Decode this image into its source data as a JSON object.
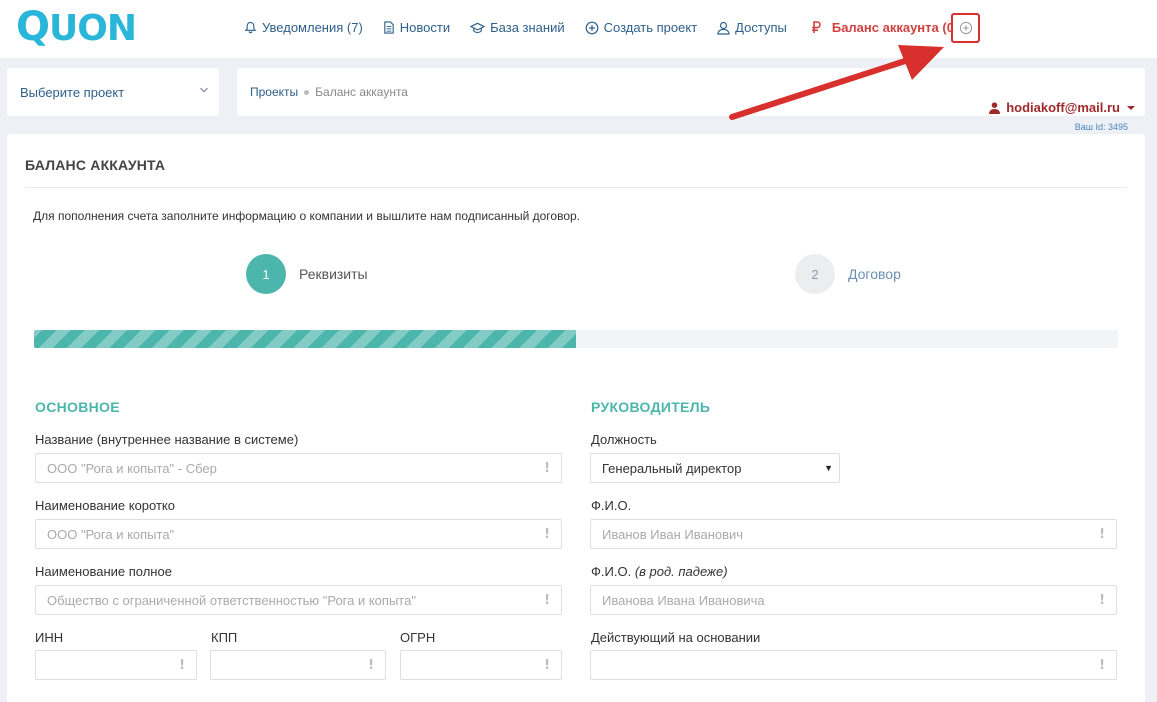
{
  "logo": {
    "text": "QUON"
  },
  "nav": {
    "notifications": "Уведомления (7)",
    "news": "Новости",
    "knowledge_base": "База знаний",
    "create_project": "Создать проект",
    "access": "Доступы",
    "balance": "Баланс аккаунта (0 р.)"
  },
  "project_select": {
    "placeholder": "Выберите проект"
  },
  "breadcrumb": {
    "items": [
      "Проекты",
      "Баланс аккаунта"
    ]
  },
  "user": {
    "email": "hodiakoff@mail.ru",
    "id_label": "Ваш Id: 3495"
  },
  "card": {
    "title": "БАЛАНС АККАУНТА",
    "intro": "Для пополнения счета заполните информацию о компании и вышлите нам подписанный договор.",
    "steps": [
      {
        "number": "1",
        "label": "Реквизиты"
      },
      {
        "number": "2",
        "label": "Договор"
      }
    ],
    "progress_fraction": 0.5
  },
  "form": {
    "main_section": "ОСНОВНОЕ",
    "manager_section": "РУКОВОДИТЕЛЬ",
    "name_internal": {
      "label": "Название (внутреннее название в системе)",
      "placeholder": "ООО \"Рога и копыта\" - Сбер"
    },
    "name_short": {
      "label": "Наименование коротко",
      "placeholder": "ООО \"Рога и копыта\""
    },
    "name_full": {
      "label": "Наименование полное",
      "placeholder": "Общество с ограниченной ответственностью \"Рога и копыта\""
    },
    "inn": {
      "label": "ИНН",
      "placeholder": ""
    },
    "kpp": {
      "label": "КПП",
      "placeholder": ""
    },
    "ogrn": {
      "label": "ОГРН",
      "placeholder": ""
    },
    "position": {
      "label": "Должность",
      "value": "Генеральный директор"
    },
    "fio": {
      "label": "Ф.И.О.",
      "placeholder": "Иванов Иван Иванович"
    },
    "fio_genitive": {
      "label": "Ф.И.О.",
      "hint": "(в род. падеже)",
      "placeholder": "Иванова Ивана Ивановича"
    },
    "acting_basis": {
      "label": "Действующий на основании",
      "placeholder": ""
    },
    "required_mark": "!"
  },
  "colors": {
    "accent": "#4db6ac",
    "link": "#2e5f8a",
    "balance": "#d24040",
    "annotation": "#d8302c"
  }
}
